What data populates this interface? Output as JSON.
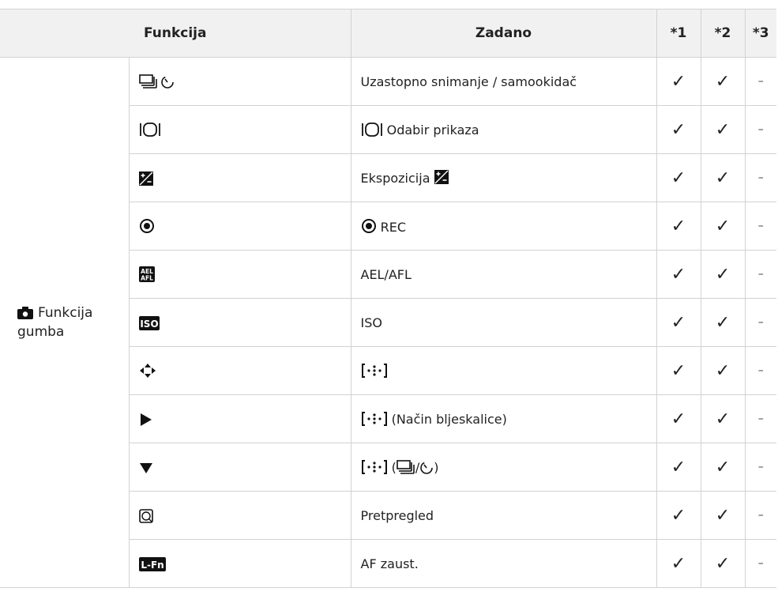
{
  "table": {
    "headers": {
      "function": "Funkcija",
      "default": "Zadano",
      "col1": "*1",
      "col2": "*2",
      "col3": "*3"
    },
    "group": {
      "icon": "camera-icon",
      "line1": "Funkcija",
      "line2": "gumba"
    },
    "rows": [
      {
        "icon": "sequential-selftimer-icon",
        "default": "Uzastopno snimanje / samookidač",
        "c1": "✓",
        "c2": "✓",
        "c3": "–"
      },
      {
        "icon": "display-selection-icon",
        "default": "Odabir prikaza",
        "c1": "✓",
        "c2": "✓",
        "c3": "–"
      },
      {
        "icon": "exposure-compensation-icon",
        "default": "Ekspozicija",
        "c1": "✓",
        "c2": "✓",
        "c3": "–"
      },
      {
        "icon": "record-icon",
        "default": "REC",
        "c1": "✓",
        "c2": "✓",
        "c3": "–"
      },
      {
        "icon": "ael-afl-icon",
        "default": "AEL/AFL",
        "c1": "✓",
        "c2": "✓",
        "c3": "–"
      },
      {
        "icon": "iso-icon",
        "default": "ISO",
        "c1": "✓",
        "c2": "✓",
        "c3": "–"
      },
      {
        "icon": "four-way-arrows-icon",
        "default": "",
        "c1": "✓",
        "c2": "✓",
        "c3": "–"
      },
      {
        "icon": "right-arrow-icon",
        "default": "(Način bljeskalice)",
        "c1": "✓",
        "c2": "✓",
        "c3": "–"
      },
      {
        "icon": "down-arrow-icon",
        "default_open": "(",
        "default_sep": "/",
        "default_close": ")",
        "c1": "✓",
        "c2": "✓",
        "c3": "–"
      },
      {
        "icon": "preview-icon",
        "default": "Pretpregled",
        "c1": "✓",
        "c2": "✓",
        "c3": "–"
      },
      {
        "icon": "l-fn-icon",
        "icon_text": "L-Fn",
        "default": "AF zaust.",
        "c1": "✓",
        "c2": "✓",
        "c3": "–"
      }
    ]
  }
}
